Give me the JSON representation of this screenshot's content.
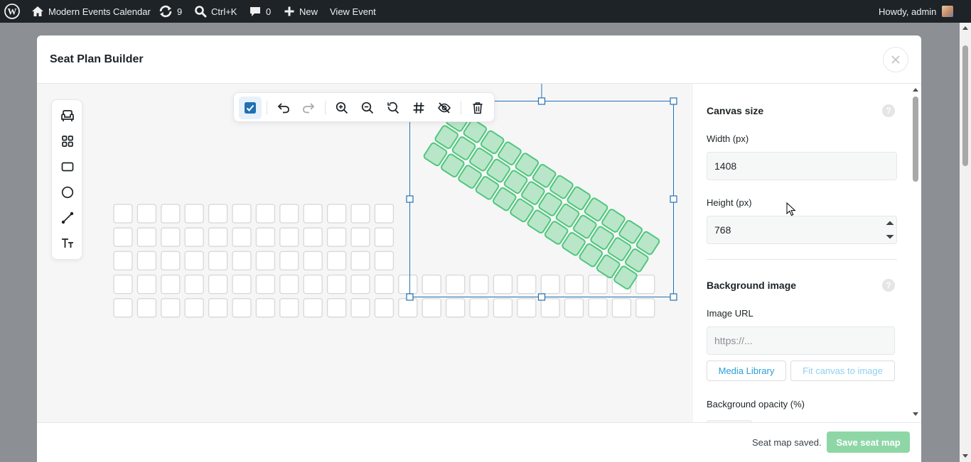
{
  "adminbar": {
    "site_name": "Modern Events Calendar",
    "updates_count": "9",
    "search_shortcut": "Ctrl+K",
    "comments_count": "0",
    "new_label": "New",
    "view_event_label": "View Event",
    "howdy": "Howdy, admin"
  },
  "modal": {
    "title": "Seat Plan Builder"
  },
  "panel": {
    "canvas_size_title": "Canvas size",
    "width_label": "Width (px)",
    "width_value": "1408",
    "height_label": "Height (px)",
    "height_value": "768",
    "bg_image_title": "Background image",
    "image_url_label": "Image URL",
    "image_url_placeholder": "https://...",
    "media_library_label": "Media Library",
    "fit_canvas_label": "Fit canvas to image",
    "bg_opacity_label": "Background opacity (%)",
    "help_glyph": "?"
  },
  "footer": {
    "status": "Seat map saved.",
    "save_label": "Save seat map"
  },
  "colors": {
    "accent": "#2271b1",
    "seat_selected_fill": "#b9e6c9",
    "seat_selected_stroke": "#4fc77c",
    "save_button": "#8fd6a7"
  },
  "seat_grid": {
    "rows": 5,
    "columns": 23,
    "upper_rows_columns": 12,
    "rotated_block_rows": 3,
    "rotated_block_columns": 12
  }
}
